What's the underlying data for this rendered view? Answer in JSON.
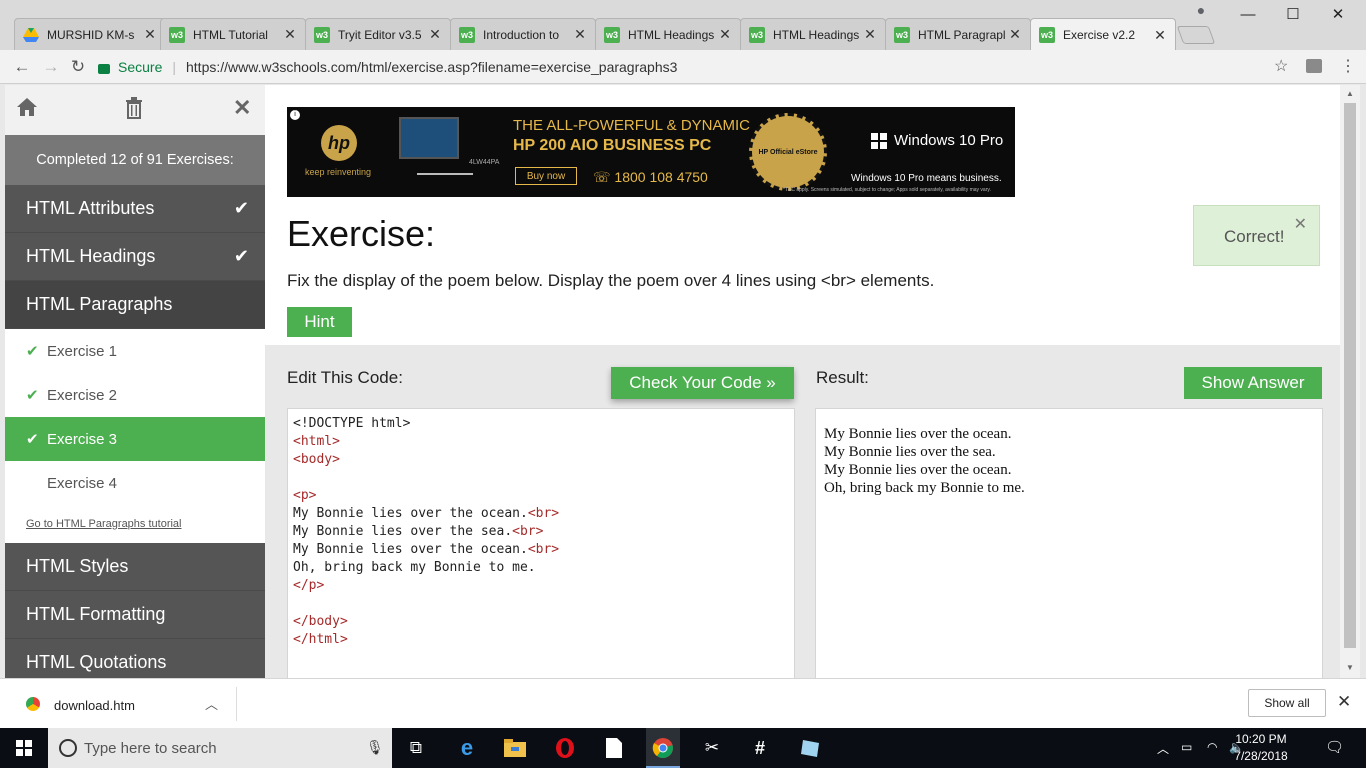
{
  "browser": {
    "tabs": [
      {
        "label": "MURSHID KM-s",
        "icon": "google-drive-icon"
      },
      {
        "label": "HTML Tutorial",
        "icon": "w3schools-icon"
      },
      {
        "label": "Tryit Editor v3.5",
        "icon": "w3schools-icon"
      },
      {
        "label": "Introduction to",
        "icon": "w3schools-icon"
      },
      {
        "label": "HTML Headings",
        "icon": "w3schools-icon"
      },
      {
        "label": "HTML Headings",
        "icon": "w3schools-icon"
      },
      {
        "label": "HTML Paragrapl",
        "icon": "w3schools-icon"
      },
      {
        "label": "Exercise v2.2",
        "icon": "w3schools-icon",
        "active": true
      }
    ],
    "secure_label": "Secure",
    "url": "https://www.w3schools.com/html/exercise.asp?filename=exercise_paragraphs3"
  },
  "sidebar": {
    "completed_text": "Completed 12 of 91 Exercises:",
    "sections_before": [
      {
        "label": "HTML Attributes",
        "done": true
      },
      {
        "label": "HTML Headings",
        "done": true
      }
    ],
    "current_section": "HTML Paragraphs",
    "exercises": [
      {
        "label": "Exercise 1",
        "done": true
      },
      {
        "label": "Exercise 2",
        "done": true
      },
      {
        "label": "Exercise 3",
        "done": true,
        "active": true
      },
      {
        "label": "Exercise 4",
        "done": false
      }
    ],
    "tutorial_link": "Go to HTML Paragraphs tutorial",
    "sections_after": [
      "HTML Styles",
      "HTML Formatting",
      "HTML Quotations"
    ]
  },
  "ad": {
    "brand_tag": "keep reinventing",
    "model": "4LW44PA",
    "headline1": "THE ALL-POWERFUL & DYNAMIC",
    "headline2": "HP 200 AIO BUSINESS PC",
    "buy": "Buy now",
    "phone": "1800 108 4750",
    "seal": "HP Official eStore",
    "windows": "Windows 10 Pro",
    "tagline": "Windows 10 Pro means business.",
    "fine_print": "*T&C apply. Screens simulated, subject to change; Apps sold separately, availability may vary."
  },
  "exercise": {
    "title": "Exercise:",
    "instruction": "Fix the display of the poem below. Display the poem over 4 lines using <br> elements.",
    "hint": "Hint",
    "correct": "Correct!",
    "edit_label": "Edit This Code:",
    "check_button": "Check Your Code »",
    "result_label": "Result:",
    "answer_button": "Show Answer",
    "code_lines": [
      "<!DOCTYPE html>",
      "<html>",
      "<body>",
      "",
      "<p>",
      "My Bonnie lies over the ocean.<br>",
      "My Bonnie lies over the sea.<br>",
      "My Bonnie lies over the ocean.<br>",
      "Oh, bring back my Bonnie to me.",
      "</p>",
      "",
      "</body>",
      "</html>"
    ],
    "result_lines": [
      "My Bonnie lies over the ocean.",
      "My Bonnie lies over the sea.",
      "My Bonnie lies over the ocean.",
      "Oh, bring back my Bonnie to me."
    ]
  },
  "downloads": {
    "file": "download.htm",
    "show_all": "Show all"
  },
  "taskbar": {
    "search_placeholder": "Type here to search",
    "time": "10:20 PM",
    "date": "7/28/2018"
  },
  "colors": {
    "accent": "#4CAF50",
    "sidebar_bg": "#555555",
    "correct_bg": "#DFF0D8"
  }
}
